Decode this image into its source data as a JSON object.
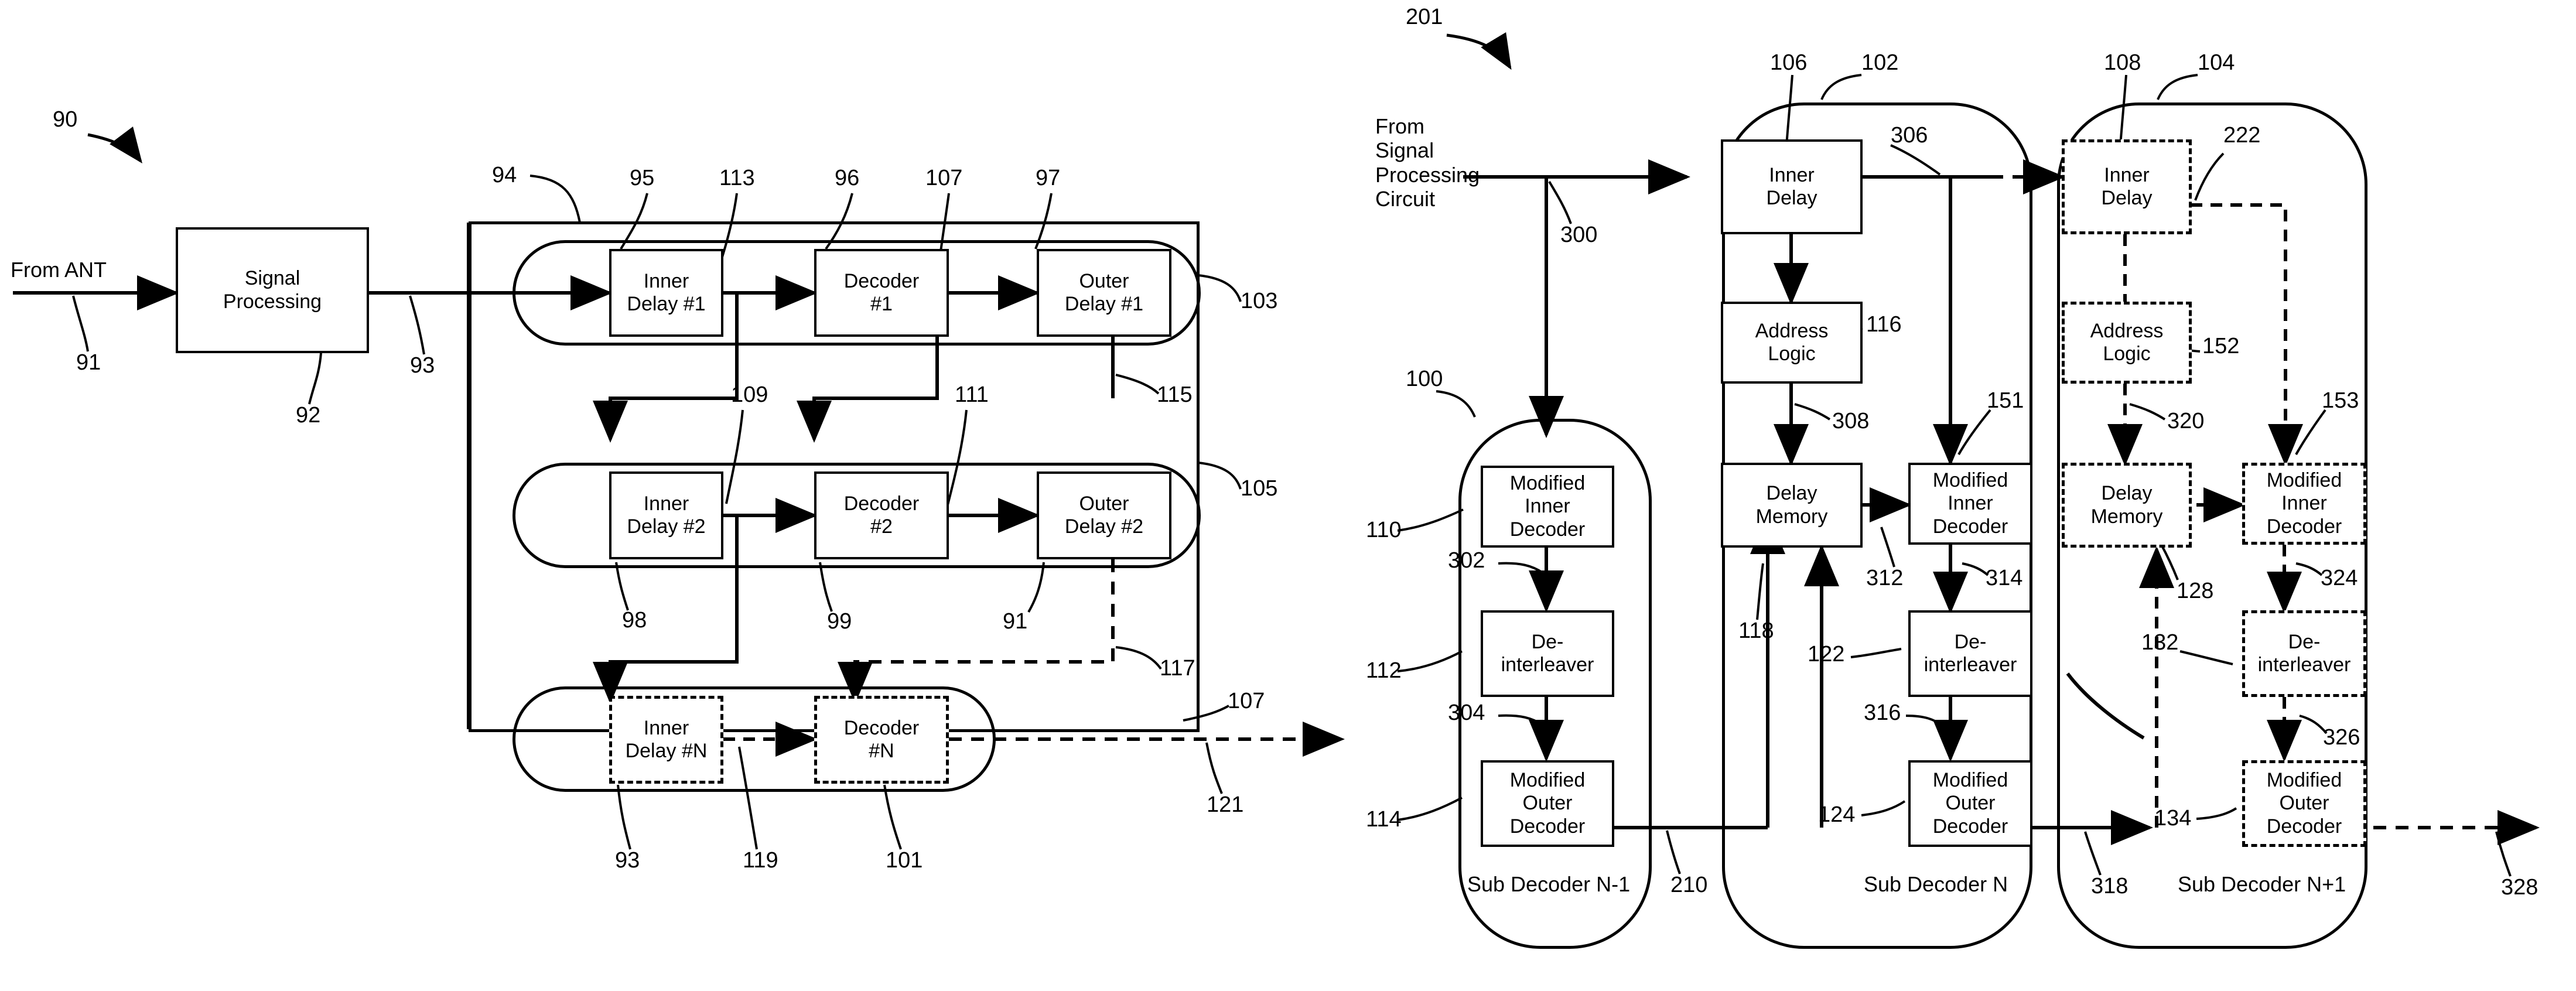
{
  "figures": [
    {
      "id": "fig-left",
      "ref": "90",
      "source_label": "From ANT",
      "signal_block": "Signal\nProcessing",
      "rows": [
        {
          "inner": "Inner\nDelay #1",
          "decoder": "Decoder\n#1",
          "outer": "Outer\nDelay #1"
        },
        {
          "inner": "Inner\nDelay #2",
          "decoder": "Decoder\n#2",
          "outer": "Outer\nDelay #2"
        },
        {
          "inner": "Inner\nDelay #N",
          "decoder": "Decoder\n#N",
          "outer": ""
        }
      ],
      "numbers": {
        "n90": "90",
        "n91": "91",
        "n92": "92",
        "n93": "93",
        "n94": "94",
        "n95": "95",
        "n96": "96",
        "n97": "97",
        "n98": "98",
        "n99": "99",
        "n91b": "91",
        "n101": "101",
        "n103": "103",
        "n105": "105",
        "n107a": "107",
        "n107b": "107",
        "n109": "109",
        "n111": "111",
        "n113": "113",
        "n115": "115",
        "n117": "117",
        "n119": "119",
        "n121": "121",
        "n93b": "93"
      }
    },
    {
      "id": "fig-right",
      "ref": "201",
      "source_label": "From\nSignal\nProcessing\nCircuit",
      "columns": [
        {
          "name": "Sub Decoder N-1",
          "caption": "Sub Decoder N-1",
          "style": "solid",
          "blocks": [
            {
              "text": "Modified\nInner\nDecoder",
              "ref": "110"
            },
            {
              "text": "De-\ninterleaver",
              "ref": "112"
            },
            {
              "text": "Modified\nOuter\nDecoder",
              "ref": "114"
            }
          ],
          "group_ref": "100"
        },
        {
          "name": "Sub Decoder N",
          "caption": "Sub Decoder N",
          "style": "solid",
          "blocks": [
            {
              "text": "Inner\nDelay",
              "ref": "106"
            },
            {
              "text": "Address\nLogic",
              "ref": "116"
            },
            {
              "text": "Delay\nMemory",
              "ref": "118"
            },
            {
              "text": "Modified\nInner\nDecoder",
              "ref": "151"
            },
            {
              "text": "De-\ninterleaver",
              "ref": "122"
            },
            {
              "text": "Modified\nOuter\nDecoder",
              "ref": "124"
            }
          ],
          "group_ref": "102"
        },
        {
          "name": "Sub Decoder N+1",
          "caption": "Sub Decoder N+1",
          "style": "dashed",
          "blocks": [
            {
              "text": "Inner\nDelay",
              "ref": "108"
            },
            {
              "text": "Address\nLogic",
              "ref": "152"
            },
            {
              "text": "Delay\nMemory",
              "ref": "128"
            },
            {
              "text": "Modified\nInner\nDecoder",
              "ref": "153"
            },
            {
              "text": "De-\ninterleaver",
              "ref": "132"
            },
            {
              "text": "Modified\nOuter\nDecoder",
              "ref": "134"
            }
          ],
          "group_ref": "104"
        }
      ],
      "signal_numbers": {
        "n300": "300",
        "n302": "302",
        "n304": "304",
        "n306": "306",
        "n308": "308",
        "n312": "312",
        "n314": "314",
        "n316": "316",
        "n318": "318",
        "n320": "320",
        "n324": "324",
        "n326": "326",
        "n328": "328",
        "n210": "210",
        "n222": "222"
      }
    }
  ],
  "colors": {
    "ink": "#000000",
    "paper": "#ffffff"
  }
}
